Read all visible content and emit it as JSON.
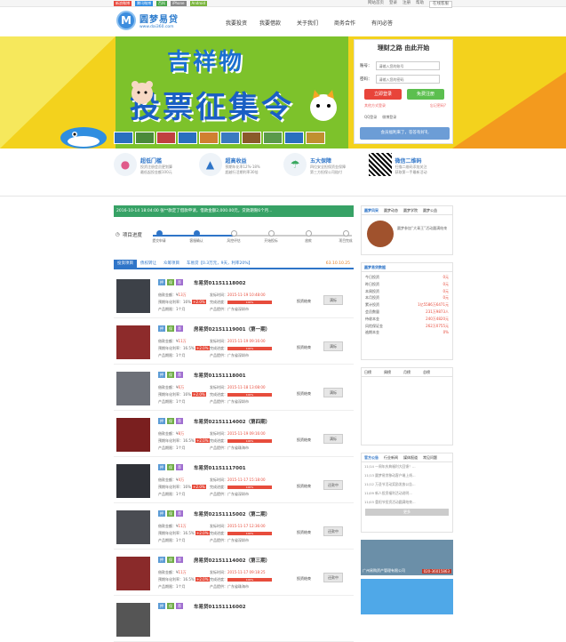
{
  "topbar": {
    "apps": [
      {
        "label": "新浪微博",
        "color": "#e84a3f"
      },
      {
        "label": "腾讯微博",
        "color": "#2e8ce3"
      },
      {
        "label": "百科",
        "color": "#47a447"
      },
      {
        "label": "iPhone",
        "color": "#888888"
      },
      {
        "label": "Android",
        "color": "#79b43b"
      }
    ],
    "home": "网站首页",
    "login": "登录",
    "register": "注册",
    "help": "帮助",
    "service": "在线客服"
  },
  "header": {
    "brand": "圆梦易贷",
    "url": "www.dai360.com",
    "nav": [
      "我要投资",
      "我要借款",
      "关于我们",
      "商务合作",
      "有问必答"
    ]
  },
  "banner": {
    "title1": "吉祥物",
    "title2": "投票征集令"
  },
  "login": {
    "title": "理财之路 由此开始",
    "user_label": "账号：",
    "user_placeholder": "请输入您的账号",
    "pwd_label": "密码：",
    "pwd_placeholder": "请输入您的密码",
    "login_btn": "立即登录",
    "register_btn": "免费注册",
    "other": "其他方式登录",
    "forgot": "忘记密码?",
    "qq": "QQ登录",
    "weibo": "微博登录",
    "notice": "会员福利来了，答答有好礼"
  },
  "features": [
    {
      "title": "超低门槛",
      "d1": "投资注册会员更划算",
      "d2": "最低起投金额100元"
    },
    {
      "title": "超高收益",
      "d1": "预期年化率12%-18%",
      "d2": "超越行活期利率30倍"
    },
    {
      "title": "五大保障",
      "d1": "四位安全担保资金保障",
      "d2": "第三方担保公司赔付"
    },
    {
      "title": "微信二维码",
      "d1": "扫描二维码添加关注",
      "d2": "获取第一手最新活动"
    }
  ],
  "announcement": "2016-10-14 18:04:00 张**款定了借款申请，借款金额2,000.00元，贷款期限6个月...",
  "progress": {
    "label": "项目进度",
    "steps": [
      "提交申请",
      "客服确认",
      "风控评估",
      "开始投标",
      "放款",
      "项目完成"
    ]
  },
  "tabs": {
    "items": [
      "投资项目",
      "债权转让",
      "众筹项目"
    ],
    "filter": "车易贷【0.3万元，9天，利率20%】",
    "countdown": "63.10.10.25"
  },
  "loans": [
    {
      "name": "车易贷01151118002",
      "amount": "13万",
      "rate": "16%",
      "rate_tag": "+2.0%",
      "time": "2015-11-19 10:48:00",
      "percent": "100%",
      "region": "广东省深圳市",
      "period": "1个月",
      "status": "投资结束",
      "btn": "满标",
      "img": "#3d4148"
    },
    {
      "name": "房易贷02151119001（第一期）",
      "amount": "11万",
      "rate": "16.5%",
      "rate_tag": "+2.0%",
      "time": "2015-11-19 09:16:00",
      "percent": "100%",
      "region": "广东省深圳市",
      "period": "1个月",
      "status": "投资结束",
      "btn": "满标",
      "img": "#8d2b2b"
    },
    {
      "name": "车易贷01151118001",
      "amount": "6万",
      "rate": "16%",
      "rate_tag": "+2.0%",
      "time": "2015-11-18 13:08:00",
      "percent": "100%",
      "region": "广东省深圳市",
      "period": "1个月",
      "status": "投资结束",
      "btn": "满标",
      "img": "#6d7078"
    },
    {
      "name": "车易贷02151114002（第四期）",
      "amount": "8万",
      "rate": "16.5%",
      "rate_tag": "+2.0%",
      "time": "2015-11-19 09:16:00",
      "percent": "100%",
      "region": "广东省珠海市",
      "period": "1个月",
      "status": "投资结束",
      "btn": "满标",
      "img": "#7a1f1f"
    },
    {
      "name": "车易贷01151117001",
      "amount": "4万",
      "rate": "16%",
      "rate_tag": "+2.0%",
      "time": "2015-11-17 15:18:00",
      "percent": "100%",
      "region": "广东省深圳市",
      "period": "1个月",
      "status": "投资结束",
      "btn": "还款中",
      "img": "#2f3137"
    },
    {
      "name": "车易贷02151115002（第二期）",
      "amount": "11万",
      "rate": "16.5%",
      "rate_tag": "+2.0%",
      "time": "2015-11-17 12:36:00",
      "percent": "100%",
      "region": "广东省深圳市",
      "period": "1个月",
      "status": "投资结束",
      "btn": "还款中",
      "img": "#4a4c52"
    },
    {
      "name": "房易贷02151114002（第三期）",
      "amount": "11万",
      "rate": "16.5%",
      "rate_tag": "+2.0%",
      "time": "2015-11-17 09:18:25",
      "percent": "100%",
      "region": "广东省珠海市",
      "period": "1个月",
      "status": "投资结束",
      "btn": "还款中",
      "img": "#8a2a2a"
    },
    {
      "name": "车易贷01151116002",
      "amount": "",
      "rate": "",
      "rate_tag": "",
      "time": "",
      "percent": "",
      "region": "",
      "period": "",
      "status": "",
      "btn": "",
      "img": "#555555"
    }
  ],
  "labels": {
    "amount": "借款金额：¥",
    "rate": "预期年化利率：",
    "period": "产品期限：",
    "time": "发标时间：",
    "done": "完成进度：",
    "region": "产品提供："
  },
  "side": {
    "tabs1": [
      "圆梦风采",
      "圆梦动态",
      "圆梦学院",
      "圆梦公益"
    ],
    "story": "圆梦参加“大青王”活动圆满结束",
    "stats_title": "圆梦易贷数据",
    "stats": [
      {
        "k": "今日投资",
        "v": "0元"
      },
      {
        "k": "昨日投资",
        "v": "0元"
      },
      {
        "k": "本周投资",
        "v": "0元"
      },
      {
        "k": "本月投资",
        "v": "0元"
      },
      {
        "k": "累计投资",
        "v": "1亿5586万6471元"
      },
      {
        "k": "会员数量",
        "v": "231万9873人"
      },
      {
        "k": "待收本金",
        "v": "240万4820元"
      },
      {
        "k": "风险保证金",
        "v": "262万0755元"
      },
      {
        "k": "逾期本金",
        "v": "0%"
      }
    ],
    "rank_tabs": [
      "日榜",
      "周榜",
      "月榜",
      "总榜"
    ],
    "news_tabs": [
      "官方公告",
      "行业新闻",
      "媒体报道",
      "常见问题"
    ],
    "news": [
      "11/14 一周年庆典福利大回馈！...",
      "11/13 圆梦易贷移动客户端上线...",
      "11/12 万圣节活动奖励发放公告...",
      "11/09 新人投资福利活动说明...",
      "11/03 重阳节投资活动圆满结束..."
    ],
    "more": "更多",
    "ad_text": "广州易购资产管理有限公司",
    "ad_phone": "020-36015863"
  }
}
